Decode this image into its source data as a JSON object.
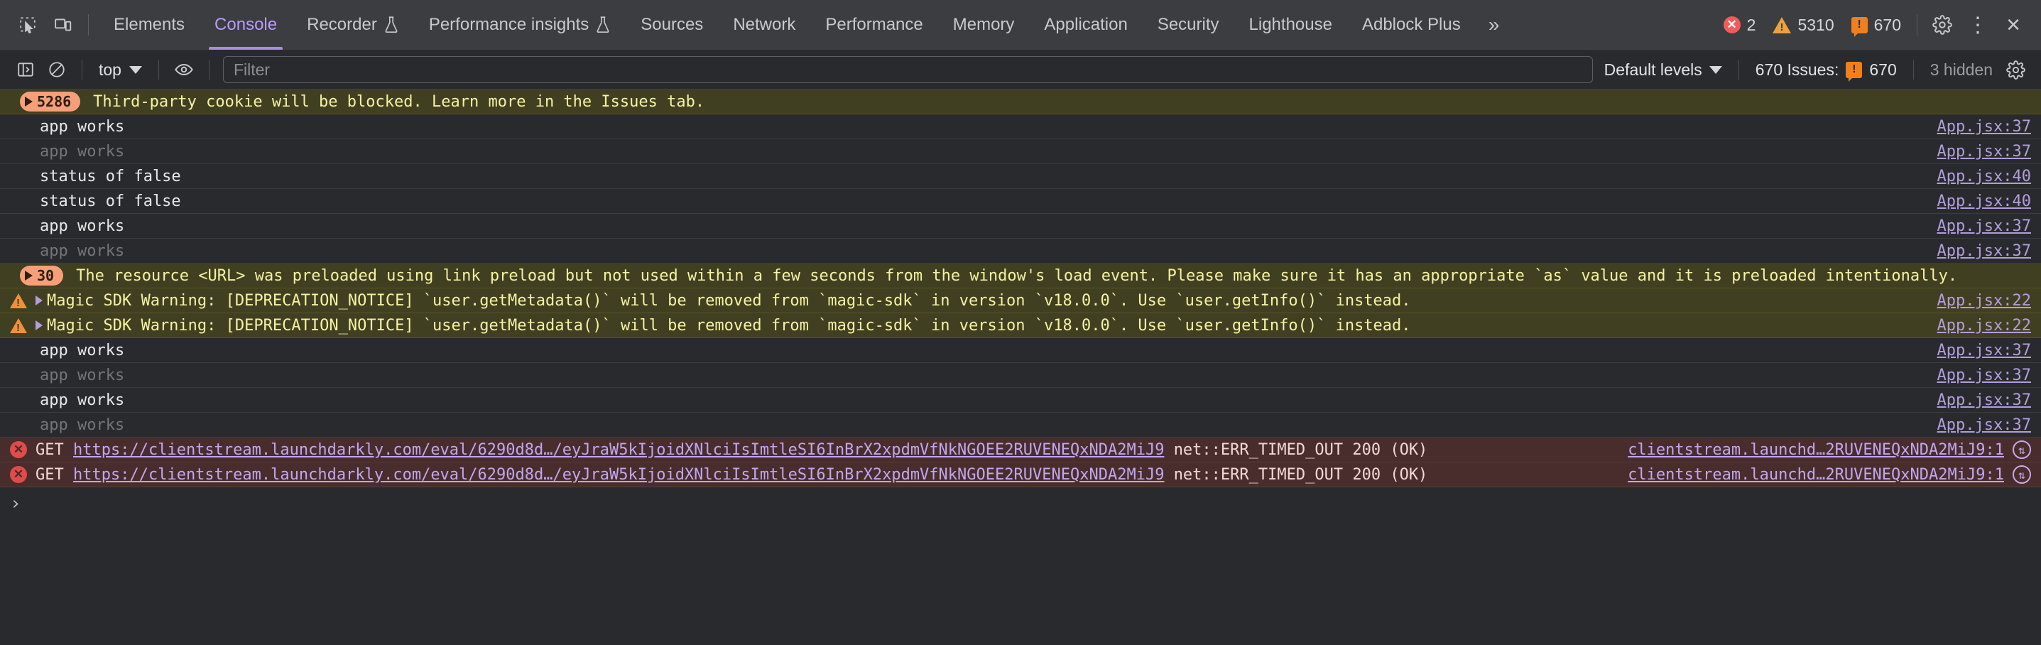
{
  "toolbar": {
    "icons": [
      {
        "name": "inspect-element-icon",
        "title": "Inspect element"
      },
      {
        "name": "device-toolbar-icon",
        "title": "Toggle device toolbar"
      }
    ],
    "tabs": [
      {
        "label": "Elements",
        "active": false,
        "experimental": false
      },
      {
        "label": "Console",
        "active": true,
        "experimental": false
      },
      {
        "label": "Recorder",
        "active": false,
        "experimental": true
      },
      {
        "label": "Performance insights",
        "active": false,
        "experimental": true
      },
      {
        "label": "Sources",
        "active": false,
        "experimental": false
      },
      {
        "label": "Network",
        "active": false,
        "experimental": false
      },
      {
        "label": "Performance",
        "active": false,
        "experimental": false
      },
      {
        "label": "Memory",
        "active": false,
        "experimental": false
      },
      {
        "label": "Application",
        "active": false,
        "experimental": false
      },
      {
        "label": "Security",
        "active": false,
        "experimental": false
      },
      {
        "label": "Lighthouse",
        "active": false,
        "experimental": false
      },
      {
        "label": "Adblock Plus",
        "active": false,
        "experimental": false
      }
    ],
    "more_tabs_label": "»",
    "error_count": "2",
    "warning_count": "5310",
    "issue_count": "670",
    "settings_label": "Settings",
    "more_options_label": "⋮",
    "close_label": "×"
  },
  "filterbar": {
    "sidebar_toggle": "console-sidebar-icon",
    "clear_console": "clear-console-icon",
    "context_value": "top",
    "eye_icon": "live-expression-icon",
    "filter_placeholder": "Filter",
    "filter_value": "",
    "levels_label": "Default levels",
    "issues_label": "670 Issues:",
    "issues_count": "670",
    "hidden_label": "3 hidden",
    "console_settings": "console-settings-icon"
  },
  "colors": {
    "accent_purple": "#bb9aff",
    "warning_bg": "#413f22",
    "warning_text": "#f5f2a0",
    "error_bg": "#492c2c",
    "error_red": "#e04b4b",
    "group_badge": "#f79f78",
    "link_purple": "#b39ddb",
    "panel_bg": "#282a2d",
    "tabbar_bg": "#3b3d40"
  },
  "console_rows": [
    {
      "kind": "groupwarn",
      "count": "5286",
      "message": "Third-party cookie will be blocked. Learn more in the Issues tab.",
      "source": ""
    },
    {
      "kind": "log",
      "dim": false,
      "message": "app works",
      "source": "App.jsx:37"
    },
    {
      "kind": "log",
      "dim": true,
      "message": "app works",
      "source": "App.jsx:37"
    },
    {
      "kind": "log",
      "dim": false,
      "message": "status of false",
      "source": "App.jsx:40"
    },
    {
      "kind": "log",
      "dim": false,
      "message": "status of false",
      "source": "App.jsx:40"
    },
    {
      "kind": "log",
      "dim": false,
      "message": "app works",
      "source": "App.jsx:37"
    },
    {
      "kind": "log",
      "dim": true,
      "message": "app works",
      "source": "App.jsx:37"
    },
    {
      "kind": "groupwarn",
      "count": "30",
      "message": "The resource <URL> was preloaded using link preload but not used within a few seconds from the window's load event. Please make sure it has an appropriate `as` value and it is preloaded intentionally.",
      "source": ""
    },
    {
      "kind": "warn",
      "message": "Magic SDK Warning: [DEPRECATION_NOTICE] `user.getMetadata()` will be removed from `magic-sdk` in version `v18.0.0`. Use `user.getInfo()` instead.",
      "source": "App.jsx:22"
    },
    {
      "kind": "warn",
      "message": "Magic SDK Warning: [DEPRECATION_NOTICE] `user.getMetadata()` will be removed from `magic-sdk` in version `v18.0.0`. Use `user.getInfo()` instead.",
      "source": "App.jsx:22"
    },
    {
      "kind": "log",
      "dim": false,
      "message": "app works",
      "source": "App.jsx:37"
    },
    {
      "kind": "log",
      "dim": true,
      "message": "app works",
      "source": "App.jsx:37"
    },
    {
      "kind": "log",
      "dim": false,
      "message": "app works",
      "source": "App.jsx:37"
    },
    {
      "kind": "log",
      "dim": true,
      "message": "app works",
      "source": "App.jsx:37"
    },
    {
      "kind": "err",
      "method": "GET",
      "url": "https://clientstream.launchdarkly.com/eval/6290d8d…/eyJraW5kIjoidXNlciIsImtleSI6InBrX2xpdmVfNkNGOEE2RUVENEQxNDA2MiJ9",
      "status": "net::ERR_TIMED_OUT 200 (OK)",
      "source": "clientstream.launchd…2RUVENEQxNDA2MiJ9:1"
    },
    {
      "kind": "err",
      "method": "GET",
      "url": "https://clientstream.launchdarkly.com/eval/6290d8d…/eyJraW5kIjoidXNlciIsImtleSI6InBrX2xpdmVfNkNGOEE2RUVENEQxNDA2MiJ9",
      "status": "net::ERR_TIMED_OUT 200 (OK)",
      "source": "clientstream.launchd…2RUVENEQxNDA2MiJ9:1"
    }
  ],
  "prompt": {
    "chevron": "›",
    "value": ""
  }
}
